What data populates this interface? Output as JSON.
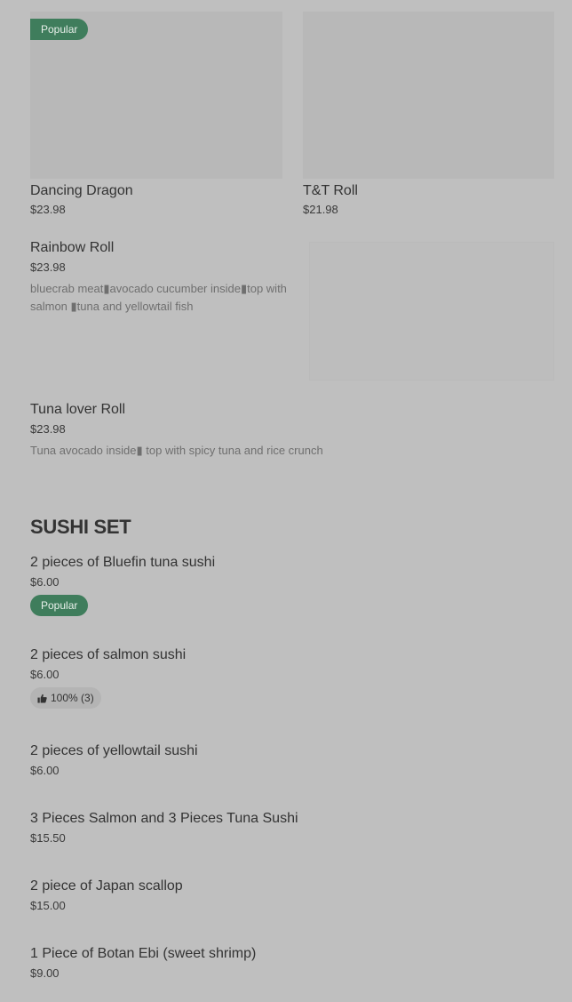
{
  "top_cards": [
    {
      "name": "Dancing Dragon",
      "price": "$23.98",
      "badge": "Popular"
    },
    {
      "name": "T&T Roll",
      "price": "$21.98"
    }
  ],
  "items": {
    "rainbow": {
      "name": "Rainbow Roll",
      "price": "$23.98",
      "description": "bluecrab meat▮avocado cucumber inside▮top with salmon ▮tuna and yellowtail fish"
    },
    "tuna_lover": {
      "name": "Tuna lover Roll",
      "price": "$23.98",
      "description": "Tuna avocado inside▮ top with spicy tuna and rice crunch"
    }
  },
  "sushi_set": {
    "title": "SUSHI SET",
    "items": [
      {
        "name": "2 pieces of Bluefin tuna sushi",
        "price": "$6.00",
        "badge": "Popular"
      },
      {
        "name": "2 pieces of salmon sushi",
        "price": "$6.00",
        "rating": "100% (3)"
      },
      {
        "name": "2 pieces of yellowtail sushi",
        "price": "$6.00"
      },
      {
        "name": "3 Pieces Salmon and 3 Pieces Tuna Sushi",
        "price": "$15.50"
      },
      {
        "name": "2 piece of Japan scallop",
        "price": "$15.00"
      },
      {
        "name": "1 Piece of Botan Ebi (sweet shrimp)",
        "price": "$9.00"
      }
    ]
  },
  "icons": {
    "rating": "thumbs-up-icon"
  },
  "colors": {
    "background": "#bfbfbf",
    "popular_badge": "#3f7d5c",
    "text": "#333333",
    "description": "#6f6f6f"
  }
}
